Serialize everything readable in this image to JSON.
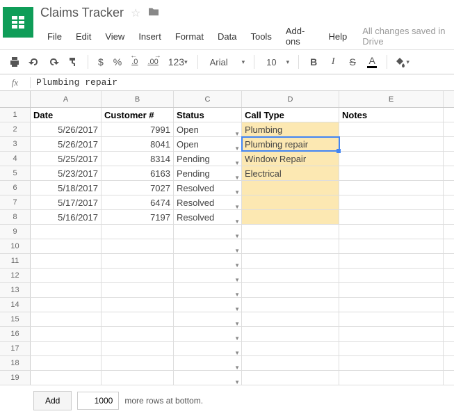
{
  "doc": {
    "title": "Claims Tracker",
    "saved": "All changes saved in Drive"
  },
  "menu": [
    "File",
    "Edit",
    "View",
    "Insert",
    "Format",
    "Data",
    "Tools",
    "Add-ons",
    "Help"
  ],
  "toolbar": {
    "currency": "$",
    "percent": "%",
    "dec_minus": ".0",
    "dec_plus": ".00",
    "more_fmt": "123",
    "font": "Arial",
    "size": "10",
    "bold": "B",
    "italic": "I",
    "strike": "S",
    "letter": "A"
  },
  "fx": {
    "value": "Plumbing repair"
  },
  "columns": [
    "A",
    "B",
    "C",
    "D",
    "E"
  ],
  "headers": {
    "A": "Date",
    "B": "Customer #",
    "C": "Status",
    "D": "Call Type",
    "E": "Notes"
  },
  "rows": [
    {
      "date": "5/26/2017",
      "cust": "7991",
      "status": "Open",
      "call": "Plumbing"
    },
    {
      "date": "5/26/2017",
      "cust": "8041",
      "status": "Open",
      "call": "Plumbing repair"
    },
    {
      "date": "5/25/2017",
      "cust": "8314",
      "status": "Pending",
      "call": "Window Repair"
    },
    {
      "date": "5/23/2017",
      "cust": "6163",
      "status": "Pending",
      "call": "Electrical"
    },
    {
      "date": "5/18/2017",
      "cust": "7027",
      "status": "Resolved",
      "call": ""
    },
    {
      "date": "5/17/2017",
      "cust": "6474",
      "status": "Resolved",
      "call": ""
    },
    {
      "date": "5/16/2017",
      "cust": "7197",
      "status": "Resolved",
      "call": ""
    }
  ],
  "selected": {
    "row": 3,
    "col": "D"
  },
  "footer": {
    "add": "Add",
    "count": "1000",
    "label": "more rows at bottom."
  }
}
